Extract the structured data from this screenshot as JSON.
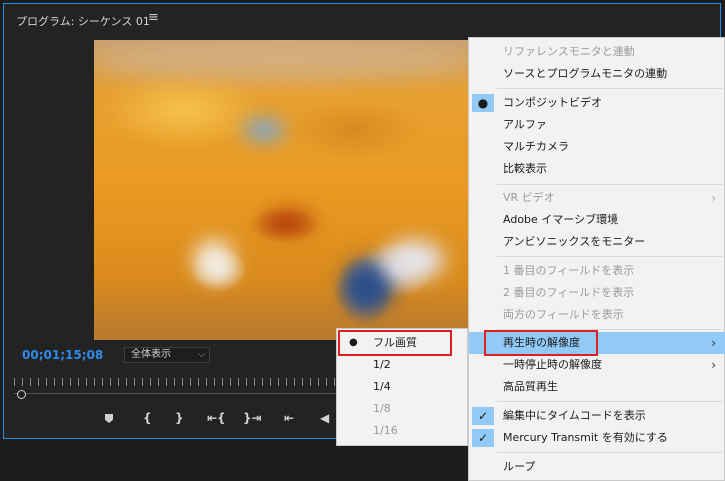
{
  "panel": {
    "title": "プログラム: シーケンス 01",
    "menu_icon": "≡"
  },
  "timecode": "00;01;15;08",
  "zoom": {
    "value": "全体表示",
    "chevron": "⌵"
  },
  "transport": {
    "mark_in": "{",
    "mark_out": "}",
    "go_in": "⇤{",
    "go_out": "}⇥",
    "step_back": "⇤",
    "prev": "◀"
  },
  "context_menu": {
    "items": [
      {
        "label": "リファレンスモニタと連動",
        "disabled": true
      },
      {
        "label": "ソースとプログラムモニタの連動"
      },
      {
        "label": "コンポジットビデオ",
        "mark": "●"
      },
      {
        "label": "アルファ"
      },
      {
        "label": "マルチカメラ"
      },
      {
        "label": "比較表示"
      },
      {
        "label": "VR ビデオ",
        "disabled": true,
        "arrow": "›"
      },
      {
        "label": "Adobe イマーシブ環境"
      },
      {
        "label": "アンビソニックスをモニター"
      },
      {
        "label": "1 番目のフィールドを表示",
        "disabled": true
      },
      {
        "label": "2 番目のフィールドを表示",
        "disabled": true
      },
      {
        "label": "両方のフィールドを表示",
        "disabled": true
      },
      {
        "label": "再生時の解像度",
        "arrow": "›",
        "highlighted": true
      },
      {
        "label": "一時停止時の解像度",
        "arrow": "›"
      },
      {
        "label": "高品質再生"
      },
      {
        "label": "編集中にタイムコードを表示",
        "mark": "✓"
      },
      {
        "label": "Mercury Transmit を有効にする",
        "mark": "✓"
      },
      {
        "label": "ループ"
      }
    ]
  },
  "submenu": {
    "items": [
      {
        "label": "フル画質",
        "mark": "●"
      },
      {
        "label": "1/2"
      },
      {
        "label": "1/4"
      },
      {
        "label": "1/8",
        "disabled": true
      },
      {
        "label": "1/16",
        "disabled": true
      }
    ]
  },
  "colors": {
    "accent": "#2d8ceb",
    "highlight": "#91c9f7",
    "annotation": "#e02020"
  }
}
